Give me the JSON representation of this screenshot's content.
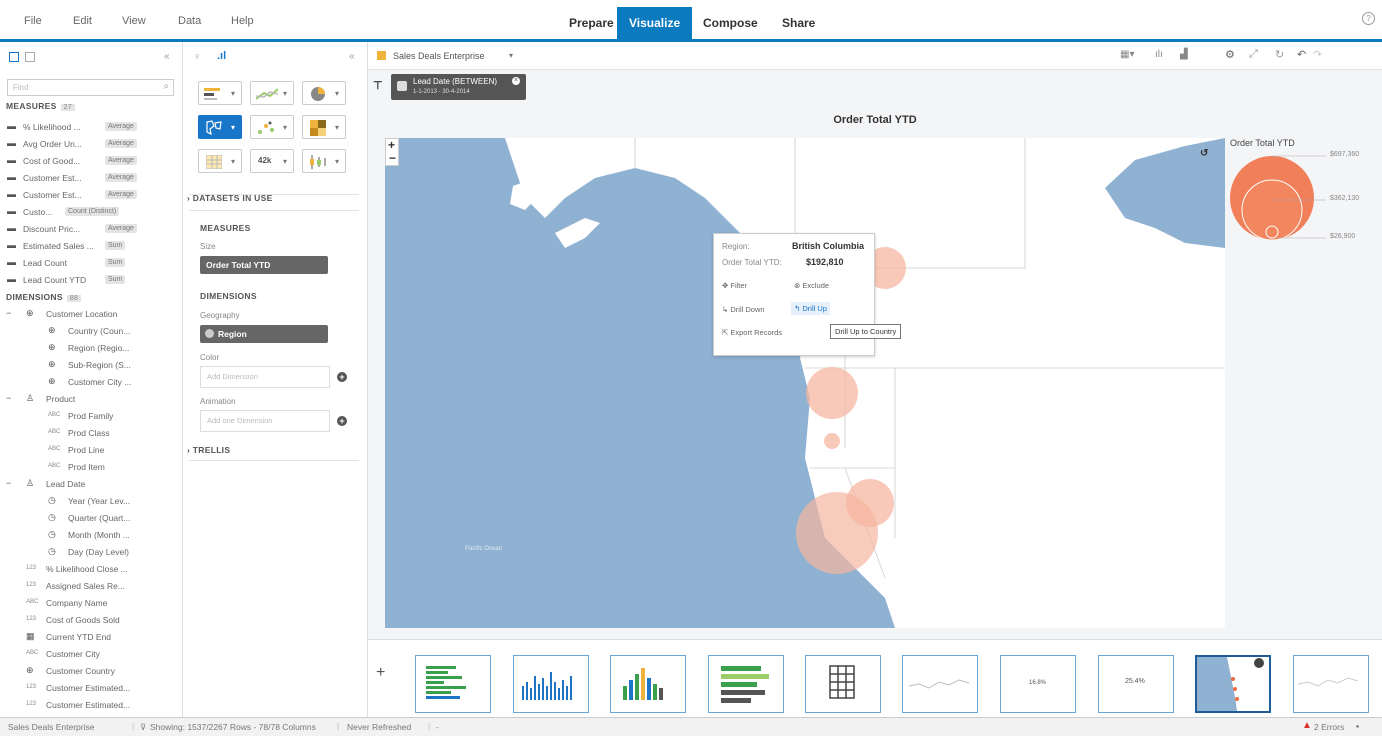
{
  "menu": {
    "items": [
      "File",
      "Edit",
      "View",
      "Data",
      "Help"
    ]
  },
  "modes": [
    {
      "label": "Prepare",
      "active": false
    },
    {
      "label": "Visualize",
      "active": true
    },
    {
      "label": "Compose",
      "active": false
    },
    {
      "label": "Share",
      "active": false
    }
  ],
  "help_icon": "question-circle-icon",
  "left_panel": {
    "collapse_glyph": "«",
    "search_placeholder": "Find",
    "measures_title": "MEASURES",
    "measures_count": "27",
    "measures": [
      {
        "label": "% Likelihood ...",
        "agg": "Average"
      },
      {
        "label": "Avg Order Un...",
        "agg": "Average"
      },
      {
        "label": "Cost of Good...",
        "agg": "Average"
      },
      {
        "label": "Customer Est...",
        "agg": "Average"
      },
      {
        "label": "Customer Est...",
        "agg": "Average"
      },
      {
        "label": "Custo...",
        "agg": "Count (Distinct)"
      },
      {
        "label": "Discount Pric...",
        "agg": "Average"
      },
      {
        "label": "Estimated Sales ...",
        "agg": "Sum"
      },
      {
        "label": "Lead Count",
        "agg": "Sum"
      },
      {
        "label": "Lead Count YTD",
        "agg": "Sum"
      }
    ],
    "dimensions_title": "DIMENSIONS",
    "dimensions_count": "88",
    "dimensions": [
      {
        "label": "Customer Location",
        "icon": "globe-icon",
        "indent": 0,
        "expand": "−"
      },
      {
        "label": "Country (Coun...",
        "icon": "globe-icon",
        "indent": 1
      },
      {
        "label": "Region (Regio...",
        "icon": "globe-icon",
        "indent": 1
      },
      {
        "label": "Sub-Region (S...",
        "icon": "globe-icon",
        "indent": 1
      },
      {
        "label": "Customer City ...",
        "icon": "globe-icon",
        "indent": 1
      },
      {
        "label": "Product",
        "icon": "hierarchy-icon",
        "indent": 0,
        "expand": "−"
      },
      {
        "label": "Prod Family",
        "icon": "abc-icon",
        "indent": 1
      },
      {
        "label": "Prod Class",
        "icon": "abc-icon",
        "indent": 1
      },
      {
        "label": "Prod Line",
        "icon": "abc-icon",
        "indent": 1
      },
      {
        "label": "Prod Item",
        "icon": "abc-icon",
        "indent": 1
      },
      {
        "label": "Lead Date",
        "icon": "hierarchy-icon",
        "indent": 0,
        "expand": "−"
      },
      {
        "label": "Year (Year Lev...",
        "icon": "clock-icon",
        "indent": 1
      },
      {
        "label": "Quarter (Quart...",
        "icon": "clock-icon",
        "indent": 1
      },
      {
        "label": "Month (Month ...",
        "icon": "clock-icon",
        "indent": 1
      },
      {
        "label": "Day (Day Level)",
        "icon": "clock-icon",
        "indent": 1
      },
      {
        "label": "% Likelihood Close ...",
        "icon": "numeric-icon",
        "indent": 0
      },
      {
        "label": "Assigned Sales Re...",
        "icon": "numeric-icon",
        "indent": 0
      },
      {
        "label": "Company Name",
        "icon": "abc-icon",
        "indent": 0
      },
      {
        "label": "Cost of Goods Sold",
        "icon": "numeric-icon",
        "indent": 0
      },
      {
        "label": "Current YTD End",
        "icon": "calendar-icon",
        "indent": 0
      },
      {
        "label": "Customer City",
        "icon": "abc-icon",
        "indent": 0
      },
      {
        "label": "Customer Country",
        "icon": "globe-icon",
        "indent": 0
      },
      {
        "label": "Customer Estimated...",
        "icon": "numeric-icon",
        "indent": 0
      },
      {
        "label": "Customer Estimated...",
        "icon": "numeric-icon",
        "indent": 0
      }
    ]
  },
  "mid_panel": {
    "collapse_glyph": "«",
    "datasets_label": "DATASETS IN USE",
    "measures_label": "MEASURES",
    "size_label": "Size",
    "size_value": "Order Total YTD",
    "dimensions_label": "DIMENSIONS",
    "geography_label": "Geography",
    "geography_value": "Region",
    "color_label": "Color",
    "color_placeholder": "Add Dimension",
    "animation_label": "Animation",
    "animation_placeholder": "Add one Dimension",
    "trellis_label": "TRELLIS",
    "viz_buttons": [
      "bar-chart-icon",
      "line-chart-icon",
      "pie-chart-icon",
      "geo-map-icon",
      "scatter-icon",
      "heat-map-icon",
      "table-icon",
      "numeric-point-icon",
      "boxplot-icon"
    ],
    "numeric_point_text": "42k"
  },
  "canvas": {
    "dataset_name": "Sales Deals Enterprise",
    "dataset_caret": "▾",
    "filter": {
      "title": "Lead Date (BETWEEN)",
      "range": "1-1-2013 - 30-4-2014"
    },
    "chart_title": "Order Total YTD",
    "zoom_in": "+",
    "zoom_out": "−",
    "ocean_label": "Pacific Ocean",
    "tooltip": {
      "region_label": "Region:",
      "region_value": "British Columbia",
      "measure_label": "Order Total YTD:",
      "measure_value": "$192,810",
      "filter": "Filter",
      "exclude": "Exclude",
      "drill_down": "Drill Down",
      "drill_up": "Drill Up",
      "export": "Export Records",
      "hint": "Drill Up to Country"
    },
    "legend": {
      "title": "Order Total YTD",
      "values": [
        "$697,360",
        "$362,130",
        "$26,900"
      ]
    },
    "thumbnails": [
      {
        "icon": "hbar-thumb"
      },
      {
        "icon": "column-thumb"
      },
      {
        "icon": "color-column-thumb"
      },
      {
        "icon": "stacked-bar-thumb"
      },
      {
        "icon": "table-thumb"
      },
      {
        "icon": "line-thumb"
      },
      {
        "icon": "point-thumb",
        "text": "16.8%"
      },
      {
        "icon": "point-thumb-2",
        "text": "25.4%"
      },
      {
        "icon": "map-thumb",
        "selected": true
      },
      {
        "icon": "line-thumb-2"
      }
    ],
    "add_thumb": "+"
  },
  "status_bar": {
    "dataset": "Sales Deals Enterprise",
    "showing": "Showing: 1537/2267 Rows - 78/78 Columns",
    "refreshed": "Never Refreshed",
    "errors": "2 Errors"
  },
  "chart_data": {
    "type": "bubble-map",
    "title": "Order Total YTD",
    "size_measure": "Order Total YTD",
    "legend_values": [
      "$697,360",
      "$362,130",
      "$26,900"
    ],
    "highlighted": {
      "region": "British Columbia",
      "value": 192810
    }
  },
  "colors": {
    "accent": "#0c7abf",
    "ocean": "#8fb2d3",
    "bubble": "#f5b6a0",
    "legend_bubble": "#f06a3e"
  }
}
